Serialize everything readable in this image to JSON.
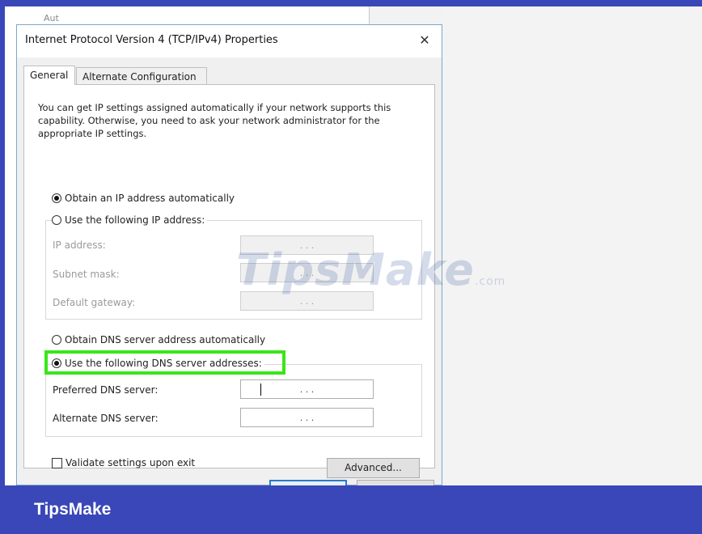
{
  "background": {
    "snippet": "Aut"
  },
  "dialog": {
    "title": "Internet Protocol Version 4 (TCP/IPv4) Properties",
    "close_glyph": "✕",
    "tabs": [
      {
        "label": "General",
        "selected": true
      },
      {
        "label": "Alternate Configuration",
        "selected": false
      }
    ],
    "intro_text": "You can get IP settings assigned automatically if your network supports this capability. Otherwise, you need to ask your network administrator for the appropriate IP settings.",
    "ip_section": {
      "auto_label": "Obtain an IP address automatically",
      "auto_selected": true,
      "manual_label": "Use the following IP address:",
      "manual_selected": false,
      "fields": [
        {
          "label": "IP address:",
          "value": ". . ."
        },
        {
          "label": "Subnet mask:",
          "value": ". . ."
        },
        {
          "label": "Default gateway:",
          "value": ". . ."
        }
      ]
    },
    "dns_section": {
      "auto_label": "Obtain DNS server address automatically",
      "auto_selected": false,
      "manual_label": "Use the following DNS server addresses:",
      "manual_selected": true,
      "fields": [
        {
          "label": "Preferred DNS server:",
          "value": ". . ."
        },
        {
          "label": "Alternate DNS server:",
          "value": ". . ."
        }
      ]
    },
    "validate_label": "Validate settings upon exit",
    "validate_checked": false,
    "advanced_label": "Advanced..."
  },
  "watermark": {
    "main": "TipsMake",
    "suffix": ".com"
  },
  "brand": {
    "name": "TipsMake"
  },
  "colors": {
    "frame": "#3a47b8",
    "highlight": "#39e619",
    "dialog_border": "#7fa7c9"
  }
}
